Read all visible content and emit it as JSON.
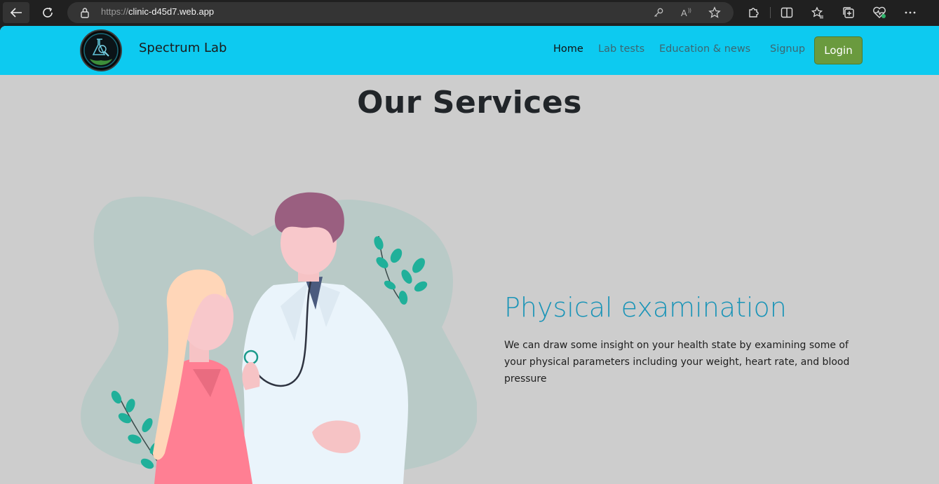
{
  "browser": {
    "url_scheme": "https://",
    "url_host": "clinic-d45d7.web.app",
    "icons": [
      "back-arrow-icon",
      "reload-icon",
      "lock-icon",
      "key-icon",
      "read-aloud-icon",
      "favorite-star-icon",
      "extensions-icon",
      "split-screen-icon",
      "favorites-icon",
      "collections-icon",
      "health-icon",
      "more-icon"
    ]
  },
  "navbar": {
    "brand": "Spectrum Lab",
    "links": [
      "Home",
      "Lab tests",
      "Education & news",
      "Signup"
    ],
    "login": "Login",
    "bg_color": "#0dcaf0",
    "login_color": "#6a9a3e"
  },
  "main": {
    "title": "Our Services",
    "service": {
      "heading": "Physical examination",
      "description": "We can draw some insight on your health state by examining some of your physical parameters including your weight, heart rate, and blood pressure",
      "heading_color": "#1a94b7"
    }
  }
}
